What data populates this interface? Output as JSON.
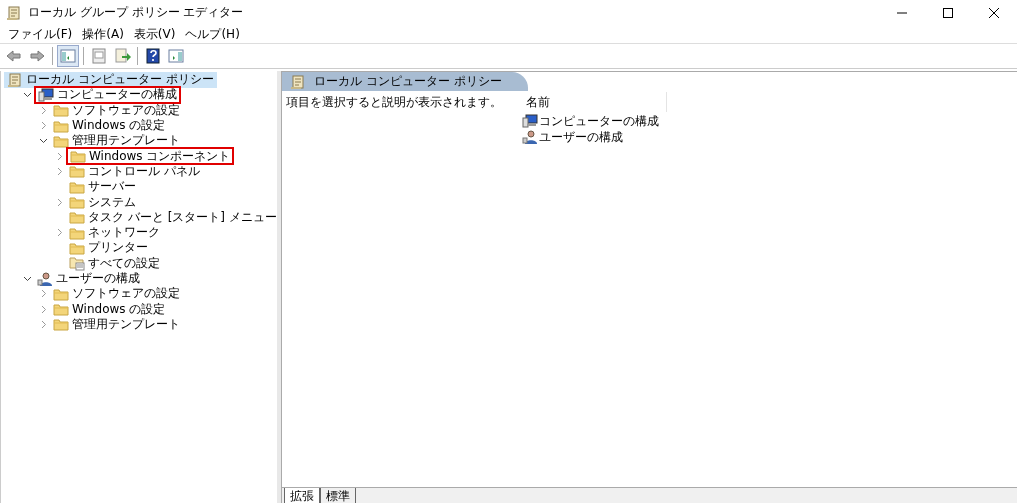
{
  "window": {
    "title": "ローカル グループ ポリシー エディター"
  },
  "menu": [
    "ファイル(F)",
    "操作(A)",
    "表示(V)",
    "ヘルプ(H)"
  ],
  "toolbar": [
    {
      "kind": "back",
      "pressed": false
    },
    {
      "kind": "forward",
      "pressed": false
    },
    {
      "kind": "sep"
    },
    {
      "kind": "tree",
      "pressed": true
    },
    {
      "kind": "sep"
    },
    {
      "kind": "properties",
      "pressed": false
    },
    {
      "kind": "export",
      "pressed": false
    },
    {
      "kind": "sep"
    },
    {
      "kind": "help",
      "pressed": false
    },
    {
      "kind": "actionpane",
      "pressed": false
    }
  ],
  "tree": [
    {
      "label": "ローカル コンピューター ポリシー",
      "kind": "policy",
      "selected": true,
      "highlighted": false,
      "children": [
        {
          "label": "コンピューターの構成",
          "kind": "computer",
          "selected": false,
          "highlighted": true,
          "expanded": true,
          "children": [
            {
              "label": "ソフトウェアの設定",
              "kind": "folder",
              "selected": false,
              "highlighted": false,
              "expanded": false
            },
            {
              "label": "Windows の設定",
              "kind": "folder",
              "selected": false,
              "highlighted": false,
              "expanded": false
            },
            {
              "label": "管理用テンプレート",
              "kind": "folder",
              "selected": false,
              "highlighted": false,
              "expanded": true,
              "children": [
                {
                  "label": "Windows コンポーネント",
                  "kind": "folder",
                  "selected": false,
                  "highlighted": true,
                  "expanded": false
                },
                {
                  "label": "コントロール パネル",
                  "kind": "folder",
                  "selected": false,
                  "highlighted": false,
                  "expanded": false
                },
                {
                  "label": "サーバー",
                  "kind": "folder",
                  "selected": false,
                  "highlighted": false
                },
                {
                  "label": "システム",
                  "kind": "folder",
                  "selected": false,
                  "highlighted": false,
                  "expanded": false
                },
                {
                  "label": "タスク バーと [スタート] メニュー",
                  "kind": "folder",
                  "selected": false,
                  "highlighted": false
                },
                {
                  "label": "ネットワーク",
                  "kind": "folder",
                  "selected": false,
                  "highlighted": false,
                  "expanded": false
                },
                {
                  "label": "プリンター",
                  "kind": "folder",
                  "selected": false,
                  "highlighted": false
                },
                {
                  "label": "すべての設定",
                  "kind": "settings",
                  "selected": false,
                  "highlighted": false
                }
              ]
            }
          ]
        },
        {
          "label": "ユーザーの構成",
          "kind": "user",
          "selected": false,
          "highlighted": false,
          "expanded": true,
          "children": [
            {
              "label": "ソフトウェアの設定",
              "kind": "folder",
              "selected": false,
              "highlighted": false,
              "expanded": false
            },
            {
              "label": "Windows の設定",
              "kind": "folder",
              "selected": false,
              "highlighted": false,
              "expanded": false
            },
            {
              "label": "管理用テンプレート",
              "kind": "folder",
              "selected": false,
              "highlighted": false,
              "expanded": false
            }
          ]
        }
      ]
    }
  ],
  "details": {
    "title": "ローカル コンピューター ポリシー",
    "description": "項目を選択すると説明が表示されます。",
    "columns": [
      "名前"
    ],
    "items": [
      {
        "label": "コンピューターの構成",
        "kind": "computer"
      },
      {
        "label": "ユーザーの構成",
        "kind": "user"
      }
    ]
  },
  "view_tabs": [
    {
      "label": "拡張",
      "selected": true
    },
    {
      "label": "標準",
      "selected": false
    }
  ]
}
